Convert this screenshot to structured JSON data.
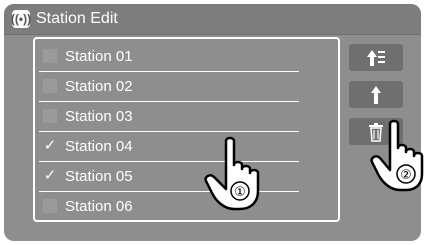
{
  "header": {
    "title": "Station Edit",
    "icon": "radio-icon"
  },
  "stations": [
    {
      "label": "Station 01",
      "checked": false
    },
    {
      "label": "Station 02",
      "checked": false
    },
    {
      "label": "Station 03",
      "checked": false
    },
    {
      "label": "Station 04",
      "checked": true
    },
    {
      "label": "Station 05",
      "checked": true
    },
    {
      "label": "Station 06",
      "checked": false
    }
  ],
  "buttons": {
    "reorder_icon": "move-to-top-icon",
    "up_icon": "arrow-up-icon",
    "delete_icon": "trash-icon"
  },
  "callouts": {
    "one": "①",
    "two": "②"
  },
  "colors": {
    "screen": "#8e8e8e",
    "titlebar": "#7d7d7d",
    "button": "#6f6f6f",
    "text": "#ffffff"
  }
}
